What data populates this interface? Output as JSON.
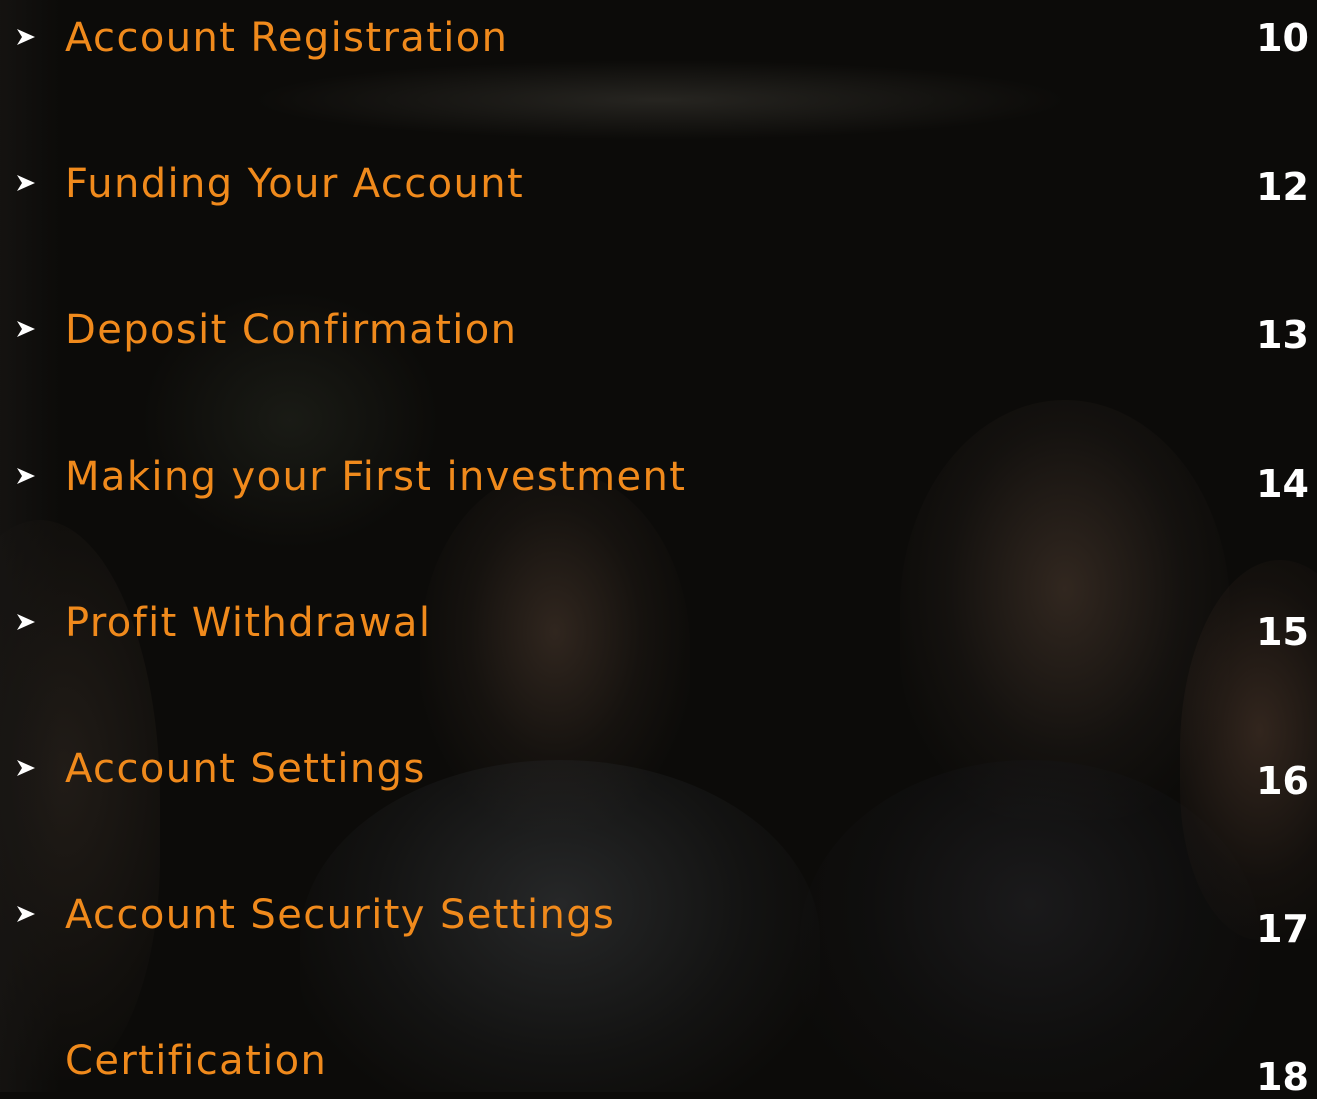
{
  "toc": {
    "items": [
      {
        "title": "Account Registration",
        "page": "10",
        "arrow": true
      },
      {
        "title": "Funding Your Account",
        "page": "12",
        "arrow": true
      },
      {
        "title": "Deposit Confirmation",
        "page": "13",
        "arrow": true
      },
      {
        "title": "Making your First investment",
        "page": "14",
        "arrow": true
      },
      {
        "title": "Profit Withdrawal",
        "page": "15",
        "arrow": true
      },
      {
        "title": "Account Settings",
        "page": "16",
        "arrow": true
      },
      {
        "title": "Account Security Settings",
        "page": "17",
        "arrow": true
      },
      {
        "title": "Certification",
        "page": "18",
        "arrow": false
      }
    ]
  },
  "colors": {
    "title": "#f08a1c",
    "page_number": "#ffffff",
    "arrow": "#ffffff",
    "background": "#0c0b09"
  },
  "icons": {
    "bullet": "chevron-right-arrow-icon"
  }
}
